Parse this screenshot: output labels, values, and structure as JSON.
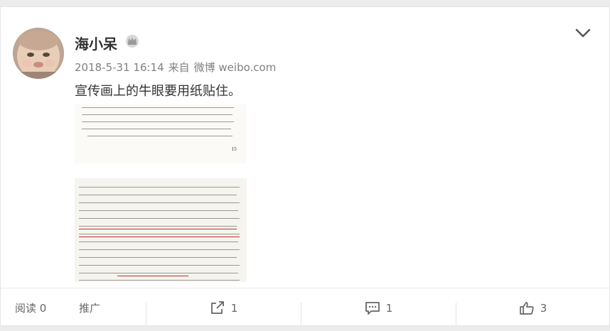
{
  "post": {
    "username": "海小呆",
    "timestamp": "2018-5-31 16:14",
    "source_prefix": "来自",
    "source": "微博 weibo.com",
    "text": "宣传画上的牛眼要用纸贴住。"
  },
  "icons": {
    "vip": "vip-crown-icon",
    "menu": "chevron-down-icon",
    "repost": "repost-icon",
    "comment": "comment-icon",
    "like": "thumbs-up-icon"
  },
  "actions": {
    "read_label": "阅读 0",
    "promote_label": "推广",
    "repost_count": "1",
    "comment_count": "1",
    "like_count": "3"
  },
  "image": {
    "page_number": "15"
  }
}
